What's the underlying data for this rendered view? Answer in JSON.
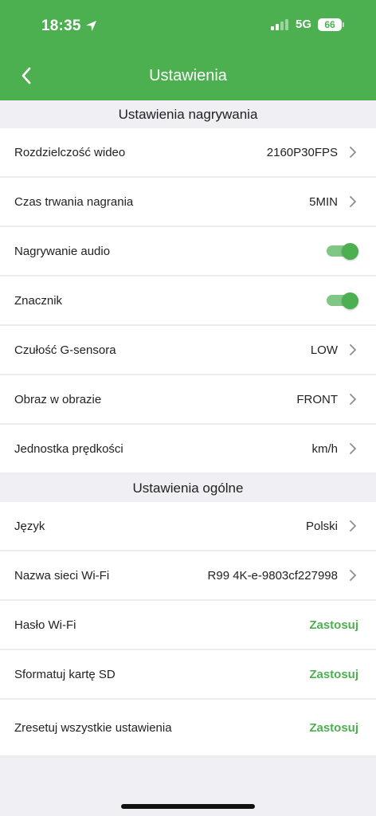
{
  "status": {
    "time": "18:35",
    "network": "5G",
    "battery": "66"
  },
  "header": {
    "title": "Ustawienia"
  },
  "sections": [
    {
      "title": "Ustawienia nagrywania",
      "rows": [
        {
          "label": "Rozdzielczość wideo",
          "value": "2160P30FPS"
        },
        {
          "label": "Czas trwania nagrania",
          "value": "5MIN"
        },
        {
          "label": "Nagrywanie audio",
          "toggle": true
        },
        {
          "label": "Znacznik",
          "toggle": true
        },
        {
          "label": "Czułość G-sensora",
          "value": "LOW"
        },
        {
          "label": "Obraz w obrazie",
          "value": "FRONT"
        },
        {
          "label": "Jednostka prędkości",
          "value": "km/h"
        }
      ]
    },
    {
      "title": "Ustawienia ogólne",
      "rows": [
        {
          "label": "Język",
          "value": "Polski"
        },
        {
          "label": "Nazwa sieci Wi-Fi",
          "value": "R99 4K-e-9803cf227998"
        },
        {
          "label": "Hasło Wi-Fi",
          "action": "Zastosuj"
        },
        {
          "label": "Sformatuj kartę SD",
          "action": "Zastosuj"
        },
        {
          "label": "Zresetuj wszystkie ustawienia",
          "action": "Zastosuj"
        }
      ]
    }
  ],
  "colors": {
    "accent": "#4caf50",
    "toggle_track": "#81c784",
    "background": "#efeff4"
  }
}
